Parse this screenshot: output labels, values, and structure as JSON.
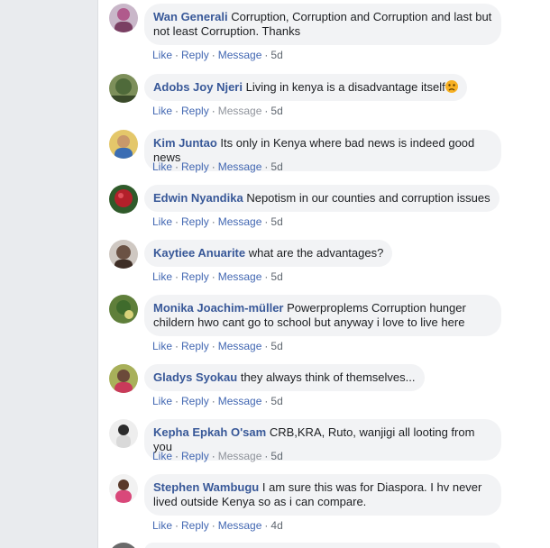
{
  "actions": {
    "like": "Like",
    "reply": "Reply",
    "message": "Message",
    "sep": "·"
  },
  "emoji": {
    "name": "frown-emoji",
    "color": "#f7b125"
  },
  "comments": [
    {
      "author": "Wan Generali",
      "text": "Corruption, Corruption and Corruption and last but not least Corruption. Thanks",
      "time": "5d",
      "avatar_color": "#b05a8c",
      "message_enabled": true
    },
    {
      "author": "Adobs Joy Njeri",
      "text": "Living in kenya is a disadvantage itself",
      "time": "5d",
      "avatar_color": "#4f6a3a",
      "message_enabled": false
    },
    {
      "author": "Kim Juntao",
      "text": "Its only in Kenya where bad news is indeed good news",
      "time": "5d",
      "avatar_color": "#3b6db3",
      "message_enabled": true
    },
    {
      "author": "Edwin Nyandika",
      "text": "Nepotism in our counties and corruption issues",
      "time": "5d",
      "avatar_color": "#b3202a",
      "message_enabled": true
    },
    {
      "author": "Kaytiee Anuarite",
      "text": "what are the advantages?",
      "time": "5d",
      "avatar_color": "#6b5244",
      "message_enabled": true
    },
    {
      "author": "Monika Joachim-müller",
      "text": "Powerproplems Corruption hunger childern hwo cant go to school but anyway i love to live here",
      "time": "5d",
      "avatar_color": "#3f6b2c",
      "message_enabled": true
    },
    {
      "author": "Gladys Syokau",
      "text": "they always think of themselves...",
      "time": "5d",
      "avatar_color": "#8a9a3a",
      "message_enabled": true
    },
    {
      "author": "Kepha Epkah O'sam",
      "text": "CRB,KRA, Ruto, wanjigi all looting from you",
      "time": "5d",
      "avatar_color": "#d9d9d9",
      "message_enabled": false
    },
    {
      "author": "Stephen Wambugu",
      "text": "I am sure this was for Diaspora. I hv never lived outside Kenya so as i can compare.",
      "time": "4d",
      "avatar_color": "#d9487a",
      "message_enabled": true
    }
  ]
}
